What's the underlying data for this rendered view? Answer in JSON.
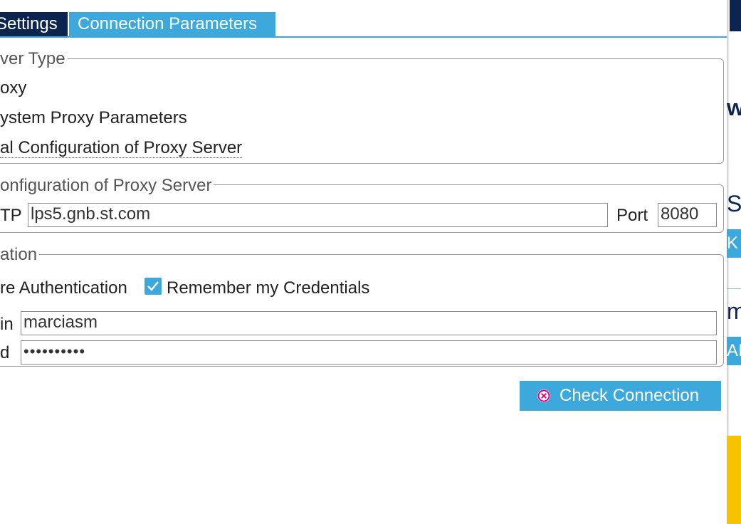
{
  "tabs": [
    {
      "label": "Settings"
    },
    {
      "label": "Connection Parameters"
    }
  ],
  "proxy_type": {
    "legend": "ver Type",
    "options": [
      {
        "label": "oxy"
      },
      {
        "label": "ystem Proxy Parameters"
      },
      {
        "label": "al Configuration of Proxy Server"
      }
    ]
  },
  "manual_config": {
    "legend": "onfiguration of Proxy Server",
    "protocol_label": "TP",
    "host_value": "lps5.gnb.st.com",
    "port_label": "Port",
    "port_value": "8080"
  },
  "authentication": {
    "legend": "ation",
    "require_label": "re Authentication",
    "remember_label": "Remember my Credentials",
    "remember_checked": true,
    "login_label": "in",
    "login_value": "marciasm",
    "password_label": "d",
    "password_value": "••••••••••"
  },
  "check_button": {
    "label": "Check Connection",
    "icon": "error-circle-icon",
    "icon_color": "#e4007c"
  },
  "background": {
    "text_1": "wa",
    "text_2": "ST",
    "chip_1": "K",
    "text_3": "m",
    "chip_2": "AI"
  },
  "colors": {
    "accent": "#3ca8dc",
    "dark_tab": "#0b2550"
  }
}
